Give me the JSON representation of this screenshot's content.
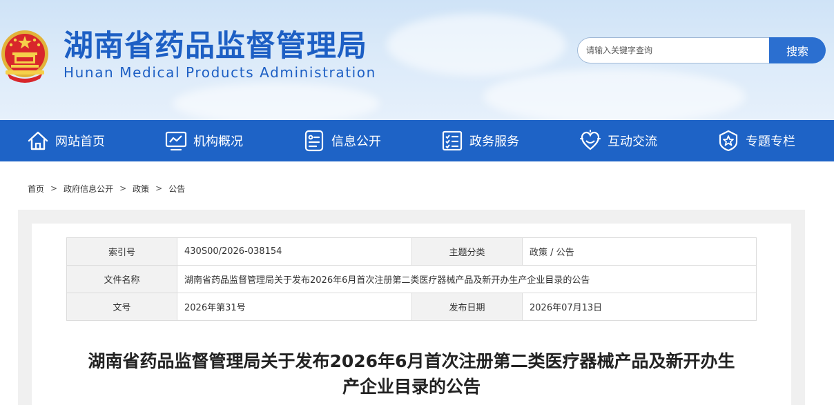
{
  "header": {
    "title": "湖南省药品监督管理局",
    "subtitle": "Hunan Medical Products Administration",
    "search": {
      "placeholder": "请输入关键字查询",
      "button_label": "搜索"
    }
  },
  "nav": {
    "items": [
      {
        "label": "网站首页",
        "icon": "home-icon"
      },
      {
        "label": "机构概况",
        "icon": "monitor-chart-icon"
      },
      {
        "label": "信息公开",
        "icon": "document-card-icon"
      },
      {
        "label": "政务服务",
        "icon": "checklist-icon"
      },
      {
        "label": "互动交流",
        "icon": "heart-hands-icon"
      },
      {
        "label": "专题专栏",
        "icon": "star-badge-icon"
      }
    ]
  },
  "breadcrumb": [
    "首页",
    "政府信息公开",
    "政策",
    "公告"
  ],
  "info": {
    "index_label": "索引号",
    "index_value": "430S00/2026-038154",
    "category_label": "主题分类",
    "category_value": "政策 / 公告",
    "name_label": "文件名称",
    "name_value": "湖南省药品监督管理局关于发布2026年6月首次注册第二类医疗器械产品及新开办生产企业目录的公告",
    "docno_label": "文号",
    "docno_value": "2026年第31号",
    "date_label": "发布日期",
    "date_value": "2026年07月13日"
  },
  "article": {
    "title_line1": "湖南省药品监督管理局关于发布2026年6月首次注册第二类医疗器械产品及新开办生",
    "title_line2": "产企业目录的公告"
  },
  "colors": {
    "brand": "#1e63c6",
    "title_blue": "#1d5fc4",
    "label_bg": "#f2f2f2"
  }
}
